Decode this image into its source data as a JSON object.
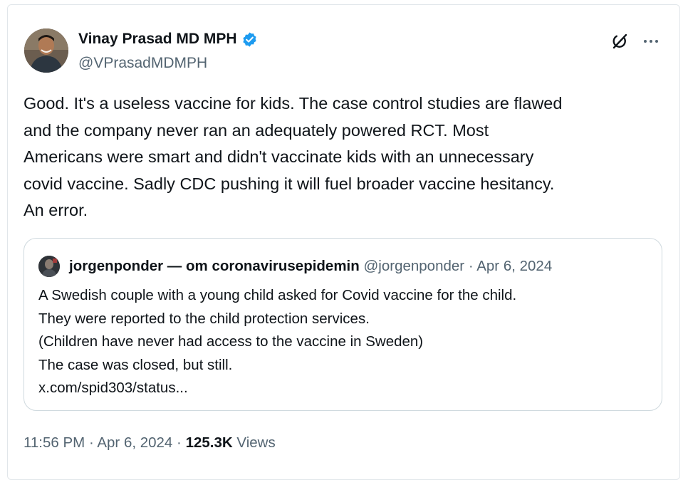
{
  "author": {
    "display_name": "Vinay Prasad MD MPH",
    "handle": "@VPrasadMDMPH",
    "verified_color": "#1d9bf0"
  },
  "tweet": {
    "lines": [
      "Good. It's a useless vaccine for kids. The case control studies are flawed",
      "and the company never ran an adequately powered RCT.  Most",
      "Americans were smart and didn't vaccinate kids with an unnecessary",
      "covid vaccine. Sadly CDC pushing it will fuel broader vaccine hesitancy.",
      "An error."
    ]
  },
  "quote": {
    "display_name": "jorgenponder — om coronavirusepidemin",
    "handle": "@jorgenponder",
    "separator": "·",
    "date": "Apr 6, 2024",
    "lines": [
      "A Swedish couple with a young child asked for Covid vaccine for the child.",
      "They were reported to the child protection services.",
      "(Children have never had access to the vaccine in Sweden)",
      "The case was closed, but still.",
      "x.com/spid303/status..."
    ]
  },
  "footer": {
    "time": "11:56 PM",
    "separator": "·",
    "date": "Apr 6, 2024",
    "views_count": "125.3K",
    "views_label": "Views"
  },
  "icons": {
    "verified": "verified-badge-icon",
    "grok": "grok-icon",
    "more": "more-horizontal-icon"
  }
}
